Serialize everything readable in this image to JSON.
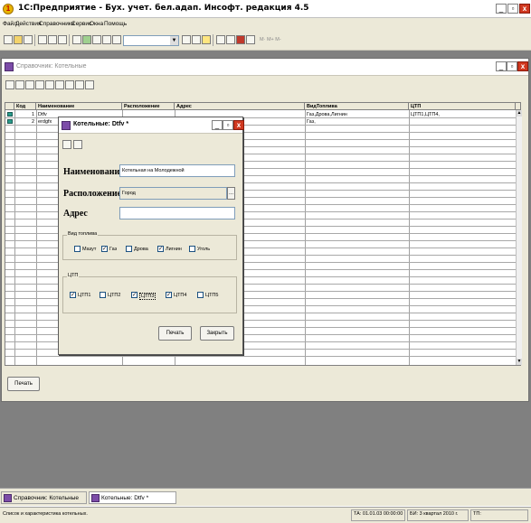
{
  "app": {
    "title": "1С:Предприятие - Бух. учет. бел.адап. Инсофт. редакция 4.5"
  },
  "menu": [
    "Файл",
    "Действия",
    "Справочники",
    "Сервис",
    "Окна",
    "Помощь"
  ],
  "toolbar": {
    "right_text": "М· М+ М-"
  },
  "directory": {
    "title": "Справочник: Котельные",
    "columns": [
      "Код",
      "Наименование",
      "Расположение",
      "Адрес",
      "ВидТоплива",
      "ЦТП"
    ],
    "rows": [
      {
        "code": "1",
        "name": "Dtfv",
        "location": "",
        "address": "",
        "fuel": "Газ,Дрова,Лигнин",
        "ctp": "ЦТП1,ЦТП4,"
      },
      {
        "code": "2",
        "name": "erdgfx",
        "location": "",
        "address": "",
        "fuel": "Газ,",
        "ctp": ""
      }
    ],
    "print_button": "Печать"
  },
  "dialog": {
    "title": "Котельные: Dtfv *",
    "name_label": "Наименование",
    "name_value": "Котельная на Молодежной",
    "location_label": "Расположение",
    "location_value": "Город",
    "location_button": "...",
    "address_label": "Адрес",
    "address_value": "",
    "fuel_group_label": "Вид топлива",
    "fuel_options": [
      {
        "label": "Мазут",
        "checked": false
      },
      {
        "label": "Газ",
        "checked": true
      },
      {
        "label": "Дрова",
        "checked": false
      },
      {
        "label": "Лигнин",
        "checked": true
      },
      {
        "label": "Уголь",
        "checked": false
      }
    ],
    "ctp_group_label": "ЦТП",
    "ctp_options": [
      {
        "label": "ЦТП1",
        "checked": true
      },
      {
        "label": "ЦТП2",
        "checked": false
      },
      {
        "label": "ЦТП3",
        "checked": true
      },
      {
        "label": "ЦТП4",
        "checked": true
      },
      {
        "label": "ЦТП5",
        "checked": false
      }
    ],
    "print_button": "Печать",
    "close_button": "Закрыть"
  },
  "window_tabs": [
    {
      "label": "Справочник: Котельные",
      "active": false
    },
    {
      "label": "Котельные: Dtfv *",
      "active": true
    }
  ],
  "status": {
    "message": "Список и характеристика котельных.",
    "ta": "ТА: 01.01.03 00:00:00",
    "bi": "БИ: 3 квартал 2010 г.",
    "ttp": "ТП:"
  },
  "icons": {
    "checkmark": "✓"
  }
}
